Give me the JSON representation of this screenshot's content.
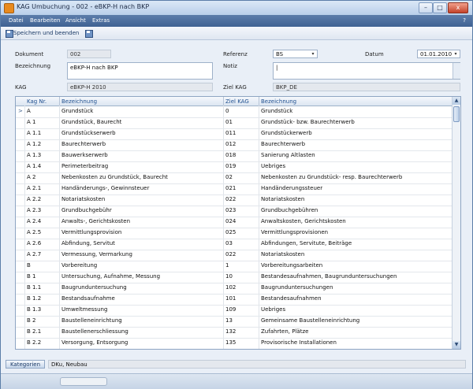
{
  "window": {
    "title": "KAG Umbuchung - 002 - eBKP-H nach BKP",
    "minimize": "–",
    "maximize": "□",
    "close": "x"
  },
  "menu": {
    "items": [
      "Datei",
      "Bearbeiten",
      "Ansicht",
      "Extras"
    ],
    "help": "?"
  },
  "toolbar": {
    "save_label": "Speichern und beenden"
  },
  "form": {
    "dokument_label": "Dokument",
    "dokument_value": "002",
    "bezeichnung_label": "Bezeichnung",
    "bezeichnung_value": "eBKP-H nach BKP",
    "kag_label": "KAG",
    "kag_value": "eBKP-H 2010",
    "referenz_label": "Referenz",
    "referenz_value": "BS",
    "datum_label": "Datum",
    "datum_value": "01.01.2010",
    "notiz_label": "Notiz",
    "notiz_value": "|",
    "ziel_kag_label": "Ziel KAG",
    "ziel_kag_value": "BKP_DE"
  },
  "grid": {
    "columns": [
      "Kag Nr.",
      "Bezeichnung",
      "Ziel KAG",
      "Bezeichnung"
    ],
    "current_row_marker": ">",
    "rows": [
      [
        "A",
        "Grundstück",
        "0",
        "Grundstück"
      ],
      [
        "A 1",
        "Grundstück, Baurecht",
        "01",
        "Grundstück- bzw. Baurechterwerb"
      ],
      [
        "A 1.1",
        "Grundstückserwerb",
        "011",
        "Grundstückerwerb"
      ],
      [
        "A 1.2",
        "Baurechterwerb",
        "012",
        "Baurechterwerb"
      ],
      [
        "A 1.3",
        "Bauwerkserwerb",
        "018",
        "Sanierung Altlasten"
      ],
      [
        "A 1.4",
        "Perimeterbeitrag",
        "019",
        "Uebriges"
      ],
      [
        "A 2",
        "Nebenkosten zu Grundstück, Baurecht",
        "02",
        "Nebenkosten zu Grundstück- resp. Baurechterwerb"
      ],
      [
        "A 2.1",
        "Handänderungs-, Gewinnsteuer",
        "021",
        "Handänderungssteuer"
      ],
      [
        "A 2.2",
        "Notariatskosten",
        "022",
        "Notariatskosten"
      ],
      [
        "A 2.3",
        "Grundbuchgebühr",
        "023",
        "Grundbuchgebühren"
      ],
      [
        "A 2.4",
        "Anwalts-, Gerichtskosten",
        "024",
        "Anwaltskosten, Gerichtskosten"
      ],
      [
        "A 2.5",
        "Vermittlungsprovision",
        "025",
        "Vermittlungsprovisionen"
      ],
      [
        "A 2.6",
        "Abfindung, Servitut",
        "03",
        "Abfindungen, Servitute, Beiträge"
      ],
      [
        "A 2.7",
        "Vermessung, Vermarkung",
        "022",
        "Notariatskosten"
      ],
      [
        "B",
        "Vorbereitung",
        "1",
        "Vorbereitungsarbeiten"
      ],
      [
        "B 1",
        "Untersuchung, Aufnahme, Messung",
        "10",
        "Bestandesaufnahmen, Baugrunduntersuchungen"
      ],
      [
        "B 1.1",
        "Baugrunduntersuchung",
        "102",
        "Baugrunduntersuchungen"
      ],
      [
        "B 1.2",
        "Bestandsaufnahme",
        "101",
        "Bestandesaufnahmen"
      ],
      [
        "B 1.3",
        "Umweltmessung",
        "109",
        "Uebriges"
      ],
      [
        "B 2",
        "Baustelleneinrichtung",
        "13",
        "Gemeinsame Baustelleneinrichtung"
      ],
      [
        "B 2.1",
        "Baustellenerschliessung",
        "132",
        "Zufahrten, Plätze"
      ],
      [
        "B 2.2",
        "Versorgung, Entsorgung",
        "135",
        "Provisorische Installationen"
      ]
    ]
  },
  "footer": {
    "categories_button": "Kategorien",
    "categories_value": "DKu, Neubau"
  },
  "icons": {
    "app": "app-icon",
    "save": "floppy-disk-icon",
    "dropdown": "chevron-down-icon"
  },
  "colors": {
    "menubar": "#4a6d9e",
    "accent": "#1f4f8f",
    "window_bg": "#e9eff7"
  }
}
